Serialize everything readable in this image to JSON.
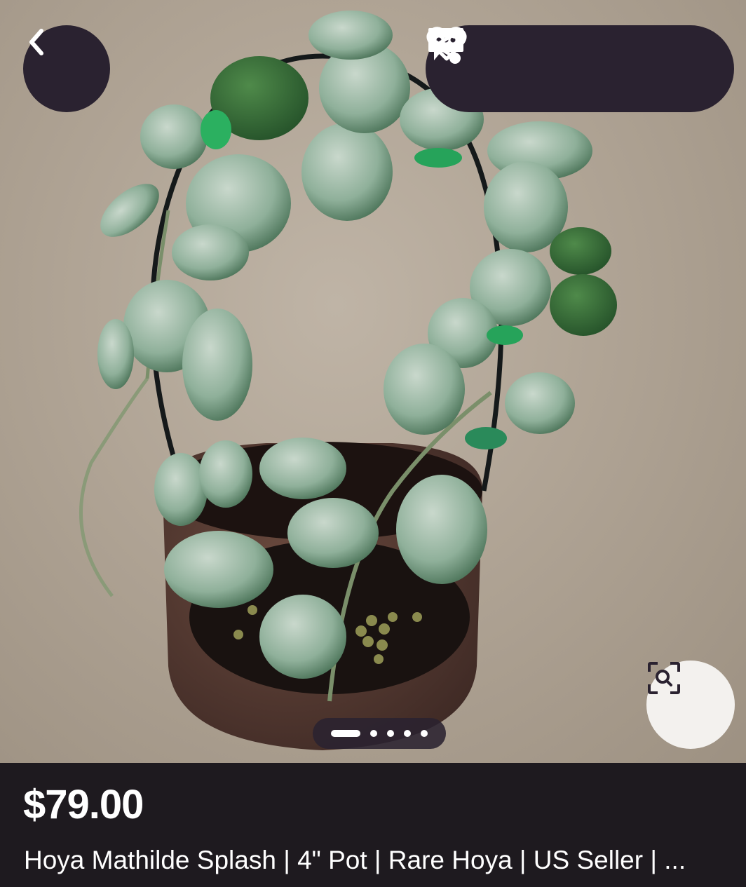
{
  "listing": {
    "price": "$79.00",
    "title": "Hoya Mathilde Splash | 4\" Pot | Rare Hoya | US Seller | ..."
  },
  "gallery": {
    "image_subject": "Potted Hoya plant on wire hoop",
    "pages": 5,
    "active_page": 1
  },
  "icons": {
    "back": "chevron-left-icon",
    "chat": "chat-bubble-icon",
    "share": "share-icon",
    "favorite": "heart-icon",
    "visual_search": "visual-search-icon"
  },
  "colors": {
    "overlay": "#2a2230",
    "info_background": "#1e1a1f",
    "photo_background": "#b0a495"
  }
}
